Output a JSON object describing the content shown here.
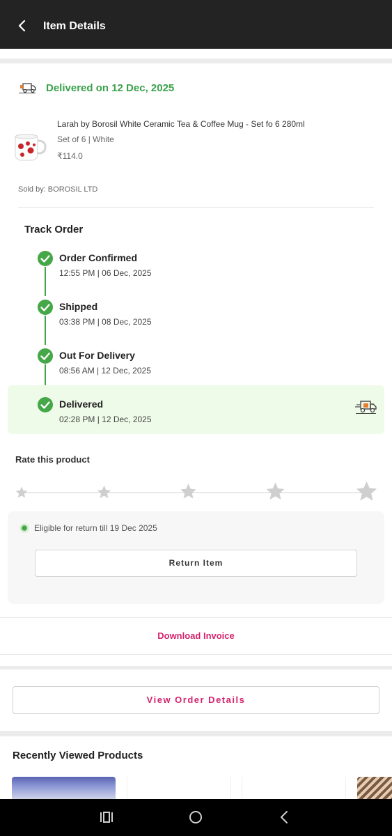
{
  "header": {
    "title": "Item Details",
    "back_icon": "chevron-left-icon"
  },
  "delivery": {
    "status": "Delivered on 12 Dec, 2025",
    "color": "#3aa14a",
    "icon": "truck-icon"
  },
  "product": {
    "name": "Larah by Borosil White Ceramic Tea & Coffee Mug - Set fo 6 280ml",
    "variant": "Set of 6 | White",
    "price": "₹114.0",
    "sold_by": "Sold by: BOROSIL LTD"
  },
  "track": {
    "title": "Track Order",
    "steps": [
      {
        "title": "Order Confirmed",
        "time": "12:55 PM | 06 Dec, 2025"
      },
      {
        "title": "Shipped",
        "time": "03:38 PM | 08 Dec, 2025"
      },
      {
        "title": "Out For Delivery",
        "time": "08:56 AM | 12 Dec, 2025"
      },
      {
        "title": "Delivered",
        "time": "02:28 PM | 12 Dec, 2025"
      }
    ],
    "check_color": "#45a747",
    "highlight_color": "#effbe9"
  },
  "rating": {
    "title": "Rate this product",
    "max_stars": 5,
    "current": 0
  },
  "return": {
    "eligible_text": "Eligible for return till 19 Dec 2025",
    "button_label": "Return Item"
  },
  "invoice": {
    "label": "Download Invoice",
    "color": "#d3246d"
  },
  "order": {
    "view_details_label": "View Order Details"
  },
  "recent": {
    "title": "Recently Viewed Products"
  },
  "navbar": {
    "icons": [
      "recent-apps-icon",
      "home-icon",
      "back-icon"
    ]
  }
}
